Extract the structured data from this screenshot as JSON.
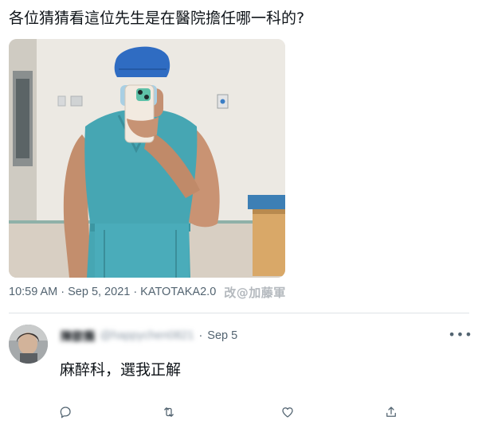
{
  "tweet": {
    "text": "各位猜猜看這位先生是在醫院擔任哪一科的?",
    "photo_icon": "selfie-photo",
    "time": "10:59 AM",
    "separator": "·",
    "date": "Sep 5, 2021",
    "source": "KATOTAKA2.0",
    "watermark": "改@加藤軍"
  },
  "reply": {
    "avatar_icon": "avatar",
    "name": "陳歆薇",
    "handle": "@happychen0821",
    "separator": "·",
    "date": "Sep 5",
    "more_label": "•••",
    "text": "麻醉科，選我正解"
  },
  "actions": {
    "reply_icon": "comment-icon",
    "retweet_icon": "retweet-icon",
    "like_icon": "heart-icon",
    "share_icon": "share-icon"
  },
  "colors": {
    "text": "#0f1419",
    "secondary": "#536471",
    "divider": "#dfe3e6",
    "scrubs": "#43a5b2",
    "surgical_cap": "#2f6cc2"
  }
}
